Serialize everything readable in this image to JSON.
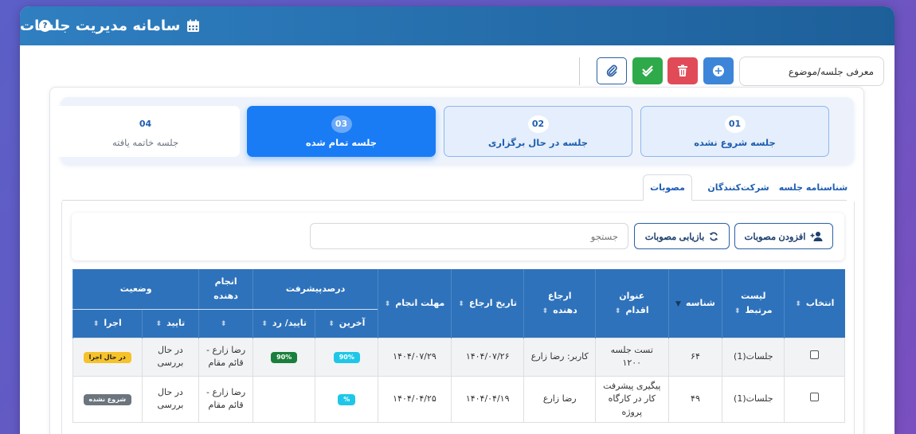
{
  "app": {
    "title": "سامانه مدیریت جلسات",
    "help": "?"
  },
  "toolbar": {
    "subject_value": "معرفی جلسه/موضوع",
    "add_icon": "plus-circle-icon",
    "delete_icon": "trash-icon",
    "approve_icon": "double-check-icon",
    "attach_icon": "paperclip-icon"
  },
  "steps": [
    {
      "num": "01",
      "label": "جلسه شروع نشده"
    },
    {
      "num": "02",
      "label": "جلسه در حال برگزاری"
    },
    {
      "num": "03",
      "label": "جلسه تمام شده"
    },
    {
      "num": "04",
      "label": "جلسه خاتمه یافته"
    }
  ],
  "tabs": [
    {
      "label": "شناسنامه جلسه"
    },
    {
      "label": "شرکت‌کنندگان"
    },
    {
      "label": "مصوبات"
    }
  ],
  "resolutions": {
    "add_label": "افزودن مصوبات",
    "refresh_label": "بازیابی مصوبات",
    "search_placeholder": "جستجو"
  },
  "table": {
    "headers": {
      "select": "انتخاب",
      "related_list": "لیست مرتبط",
      "id": "شناسه",
      "action_title": "عنوان اقدام",
      "referrer": "ارجاع دهنده",
      "referral_date": "تاریخ ارجاع",
      "deadline": "مهلت انجام",
      "progress": "درصدپیشرفت",
      "progress_last": "آخرین",
      "progress_approve": "تایید/ رد",
      "executor": "انجام دهنده",
      "status": "وضعیت",
      "status_approve": "تایید",
      "status_exec": "اجرا"
    },
    "rows": [
      {
        "related": "جلسات(1)",
        "id": "۶۴",
        "title": "تست جلسه ۱۲۰۰",
        "referrer": "کاربر: رضا زارع",
        "referral_date": "۱۴۰۴/۰۷/۲۶",
        "deadline": "۱۴۰۴/۰۷/۲۹",
        "progress_last": "90%",
        "progress_approve": "90%",
        "executor": "رضا زارع - قائم مقام",
        "approve": "در حال بررسی",
        "exec": "در حال اجرا"
      },
      {
        "related": "جلسات(1)",
        "id": "۴۹",
        "title": "پیگیری پیشرفت کار در کارگاه پروژه",
        "referrer": "رضا زارع",
        "referral_date": "۱۴۰۴/۰۴/۱۹",
        "deadline": "۱۴۰۴/۰۴/۲۵",
        "progress_last": "%",
        "progress_approve": "",
        "executor": "رضا زارع - قائم مقام",
        "approve": "در حال بررسی",
        "exec": "شروع نشده"
      }
    ]
  },
  "colors": {
    "header_bg": "#1d5f99",
    "accent": "#1a7cf5",
    "table_header": "#2e72bb",
    "badge_green": "#1a7f3c",
    "badge_cyan": "#1ec7e8",
    "badge_yellow": "#f6c22a",
    "badge_gray": "#6c757d"
  }
}
